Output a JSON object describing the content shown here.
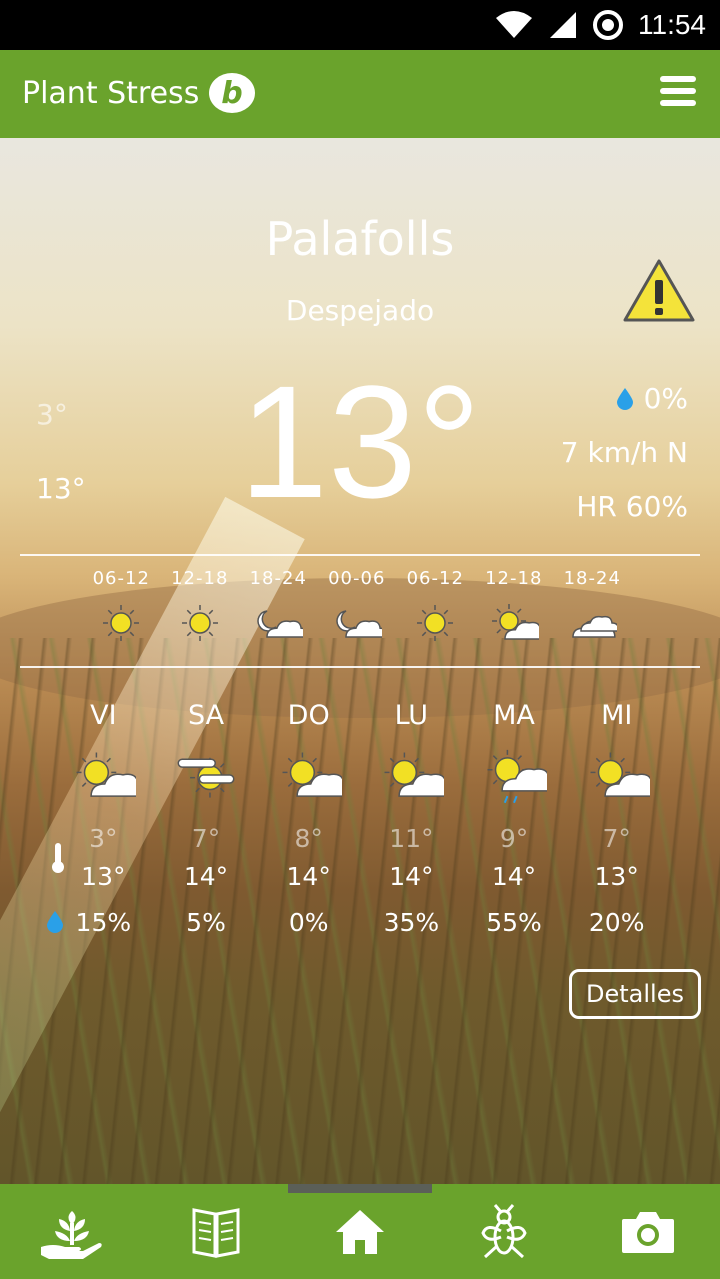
{
  "status_bar": {
    "time": "11:54"
  },
  "app_bar": {
    "title": "Plant Stress",
    "logo_letter": "b"
  },
  "current": {
    "city": "Palafolls",
    "condition": "Despejado",
    "temperature": "13°",
    "min_temp": "3°",
    "max_temp": "13°",
    "rain_prob": "0%",
    "wind": "7 km/h N",
    "humidity": "HR 60%"
  },
  "hourly": [
    {
      "label": "06-12",
      "icon": "sun-icon"
    },
    {
      "label": "12-18",
      "icon": "sun-icon"
    },
    {
      "label": "18-24",
      "icon": "moon-cloud-icon"
    },
    {
      "label": "00-06",
      "icon": "moon-cloud-icon"
    },
    {
      "label": "06-12",
      "icon": "sun-icon"
    },
    {
      "label": "12-18",
      "icon": "sun-cloud-icon"
    },
    {
      "label": "18-24",
      "icon": "cloud-icon"
    }
  ],
  "daily": [
    {
      "day": "VI",
      "icon": "sun-cloud-icon",
      "min": "3°",
      "max": "13°",
      "rain": "15%"
    },
    {
      "day": "SA",
      "icon": "sun-fog-icon",
      "min": "7°",
      "max": "14°",
      "rain": "5%"
    },
    {
      "day": "DO",
      "icon": "sun-cloud-icon",
      "min": "8°",
      "max": "14°",
      "rain": "0%"
    },
    {
      "day": "LU",
      "icon": "sun-cloud-icon",
      "min": "11°",
      "max": "14°",
      "rain": "35%"
    },
    {
      "day": "MA",
      "icon": "sun-cloud-rain-icon",
      "min": "9°",
      "max": "14°",
      "rain": "55%"
    },
    {
      "day": "MI",
      "icon": "sun-cloud-icon",
      "min": "7°",
      "max": "13°",
      "rain": "20%"
    }
  ],
  "details_button": "Detalles",
  "nav": [
    {
      "icon": "plant-hand-icon"
    },
    {
      "icon": "book-icon"
    },
    {
      "icon": "home-icon",
      "active": true
    },
    {
      "icon": "insect-icon"
    },
    {
      "icon": "camera-icon"
    }
  ],
  "colors": {
    "brand_green": "#6aa32c",
    "warning_yellow": "#f4e33a",
    "rain_blue": "#2aa0e8",
    "sun_yellow": "#f2e024"
  }
}
